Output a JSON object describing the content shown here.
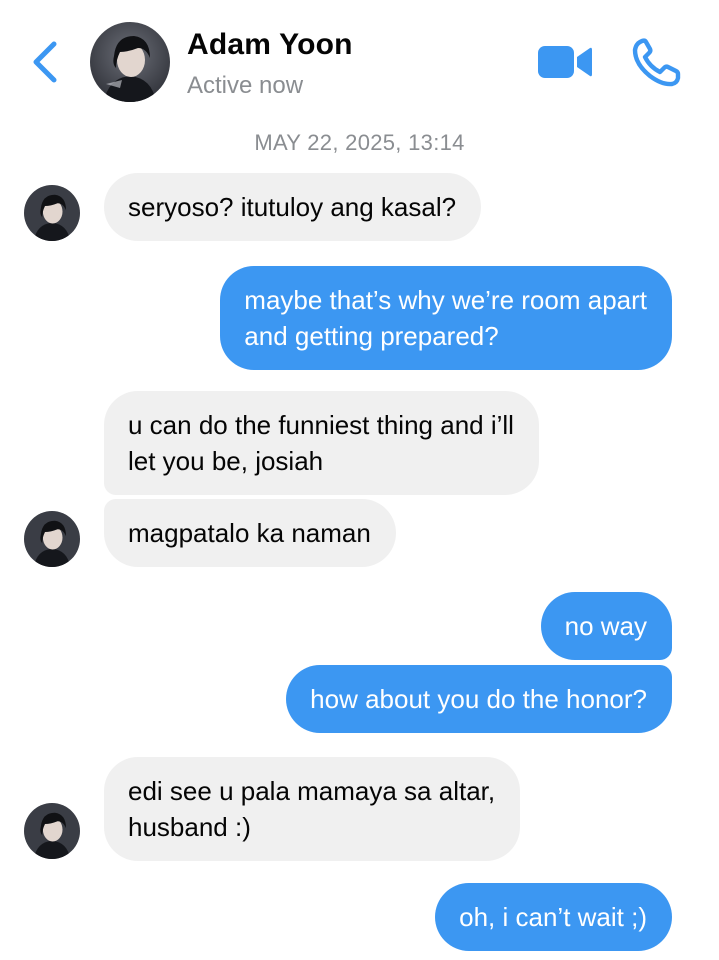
{
  "header": {
    "contact_name": "Adam Yoon",
    "status": "Active now",
    "icons": [
      "back-chevron-icon",
      "avatar",
      "video-call-icon",
      "phone-icon"
    ],
    "accent_color": "#3c97f2"
  },
  "thread": {
    "timestamp": "MAY 22, 2025, 13:14",
    "messages": [
      {
        "sender": "Adam Yoon",
        "direction": "incoming",
        "text": "seryoso? itutuloy ang kasal?"
      },
      {
        "sender": "me",
        "direction": "outgoing",
        "lines": [
          "maybe that’s why we’re room apart",
          "and getting prepared?"
        ]
      },
      {
        "sender": "Adam Yoon",
        "direction": "incoming",
        "lines": [
          "u can do the funniest thing and i’ll",
          "let you be, josiah"
        ]
      },
      {
        "sender": "Adam Yoon",
        "direction": "incoming",
        "text": "magpatalo ka naman"
      },
      {
        "sender": "me",
        "direction": "outgoing",
        "text": "no way"
      },
      {
        "sender": "me",
        "direction": "outgoing",
        "text": "how about you do the honor?"
      },
      {
        "sender": "Adam Yoon",
        "direction": "incoming",
        "lines": [
          "edi see u pala mamaya sa altar,",
          "husband :)"
        ]
      },
      {
        "sender": "me",
        "direction": "outgoing",
        "text": "oh, i can’t wait ;)"
      }
    ]
  },
  "colors": {
    "incoming_bubble": "#f0f0f0",
    "outgoing_bubble": "#3c97f2",
    "secondary_text": "#8a8d91"
  }
}
